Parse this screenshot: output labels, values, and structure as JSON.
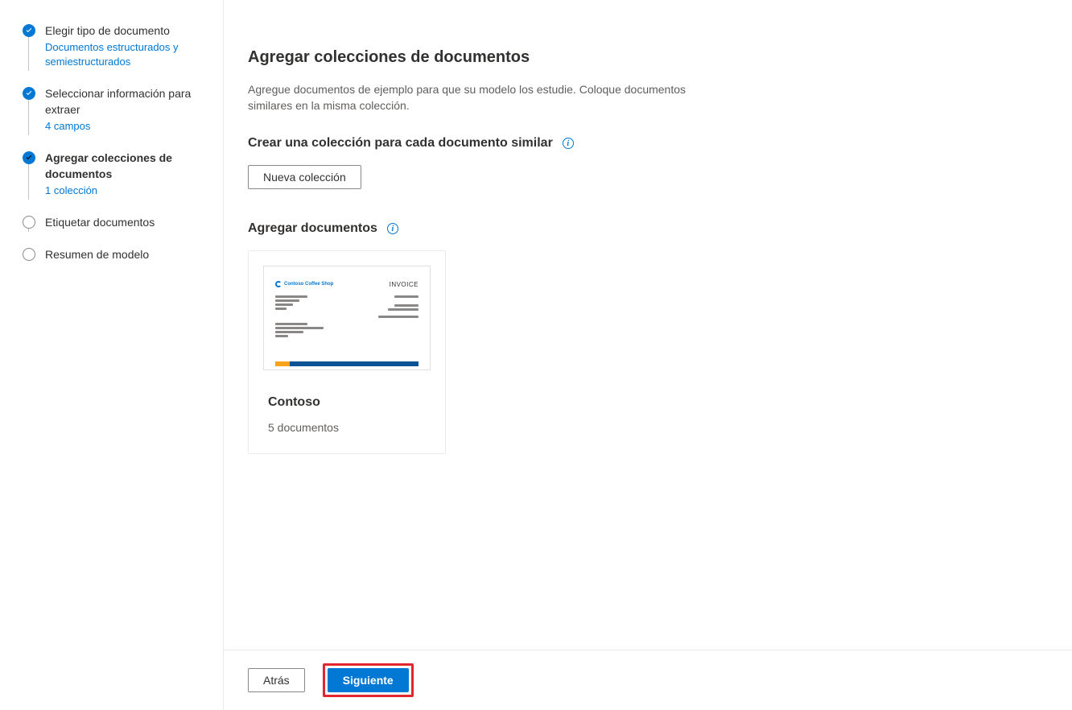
{
  "sidebar": {
    "steps": [
      {
        "title": "Elegir tipo de documento",
        "sub": "Documentos estructurados y semiestructurados",
        "state": "completed"
      },
      {
        "title": "Seleccionar información para extraer",
        "sub": "4 campos",
        "state": "completed"
      },
      {
        "title": "Agregar colecciones de documentos",
        "sub": "1 colección",
        "state": "current"
      },
      {
        "title": "Etiquetar documentos",
        "sub": "",
        "state": "pending"
      },
      {
        "title": "Resumen de modelo",
        "sub": "",
        "state": "pending"
      }
    ]
  },
  "main": {
    "title": "Agregar colecciones de documentos",
    "desc": "Agregue documentos de ejemplo para que su modelo los estudie. Coloque documentos similares en la misma colección.",
    "section1": "Crear una colección para cada documento similar",
    "new_collection_btn": "Nueva colección",
    "section2": "Agregar documentos",
    "card": {
      "name": "Contoso",
      "count": "5 documentos",
      "invoice_label": "INVOICE",
      "logo_text": "Contoso Coffee Shop"
    }
  },
  "footer": {
    "back": "Atrás",
    "next": "Siguiente"
  }
}
